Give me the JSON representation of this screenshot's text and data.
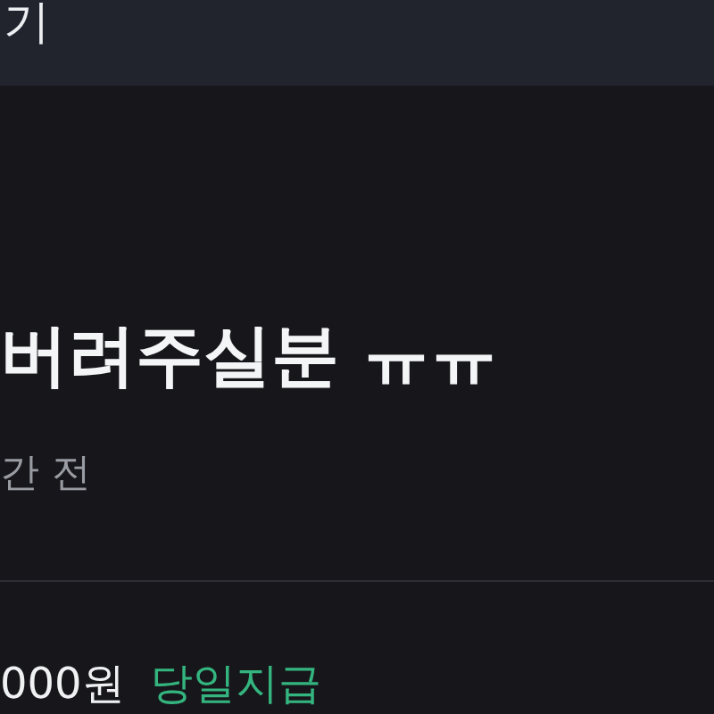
{
  "header": {
    "title": "기"
  },
  "post": {
    "title": "버려주실분 ㅠㅠ",
    "time": "간 전"
  },
  "reward": {
    "price": "000원",
    "tag": "당일지급"
  }
}
